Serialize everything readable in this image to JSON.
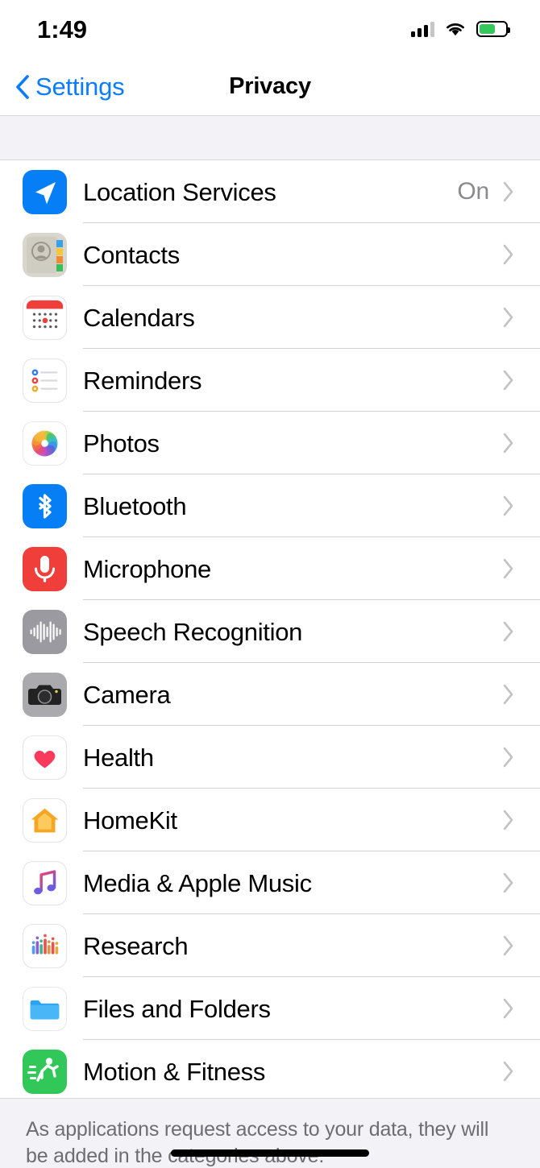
{
  "status_bar": {
    "time": "1:49",
    "signal_icon": "cellular-bars-icon",
    "wifi_icon": "wifi-icon",
    "battery_icon": "battery-icon",
    "battery_level_percent": 62,
    "battery_color": "#34c759"
  },
  "nav_bar": {
    "back_label": "Settings",
    "back_icon": "chevron-left-icon",
    "title": "Privacy",
    "tint_color": "#0a7cff"
  },
  "list": {
    "rows": [
      {
        "label": "Location Services",
        "value": "On",
        "icon": "location-arrow-icon",
        "icon_class": "ic-location"
      },
      {
        "label": "Contacts",
        "value": "",
        "icon": "contacts-icon",
        "icon_class": "ic-contacts"
      },
      {
        "label": "Calendars",
        "value": "",
        "icon": "calendar-icon",
        "icon_class": "ic-calendar"
      },
      {
        "label": "Reminders",
        "value": "",
        "icon": "reminders-icon",
        "icon_class": "ic-reminders"
      },
      {
        "label": "Photos",
        "value": "",
        "icon": "photos-icon",
        "icon_class": "ic-photos"
      },
      {
        "label": "Bluetooth",
        "value": "",
        "icon": "bluetooth-icon",
        "icon_class": "ic-bluetooth"
      },
      {
        "label": "Microphone",
        "value": "",
        "icon": "microphone-icon",
        "icon_class": "ic-mic"
      },
      {
        "label": "Speech Recognition",
        "value": "",
        "icon": "waveform-icon",
        "icon_class": "ic-speech"
      },
      {
        "label": "Camera",
        "value": "",
        "icon": "camera-icon",
        "icon_class": "ic-camera"
      },
      {
        "label": "Health",
        "value": "",
        "icon": "heart-icon",
        "icon_class": "ic-health"
      },
      {
        "label": "HomeKit",
        "value": "",
        "icon": "house-icon",
        "icon_class": "ic-homekit"
      },
      {
        "label": "Media & Apple Music",
        "value": "",
        "icon": "music-note-icon",
        "icon_class": "ic-music"
      },
      {
        "label": "Research",
        "value": "",
        "icon": "research-bars-icon",
        "icon_class": "ic-research"
      },
      {
        "label": "Files and Folders",
        "value": "",
        "icon": "folder-icon",
        "icon_class": "ic-files"
      },
      {
        "label": "Motion & Fitness",
        "value": "",
        "icon": "running-person-icon",
        "icon_class": "ic-motion"
      }
    ],
    "disclosure_icon": "chevron-right-icon"
  },
  "footer": {
    "text": "As applications request access to your data, they will be added in the categories above."
  },
  "home_indicator": {
    "icon": "home-indicator-bar"
  }
}
